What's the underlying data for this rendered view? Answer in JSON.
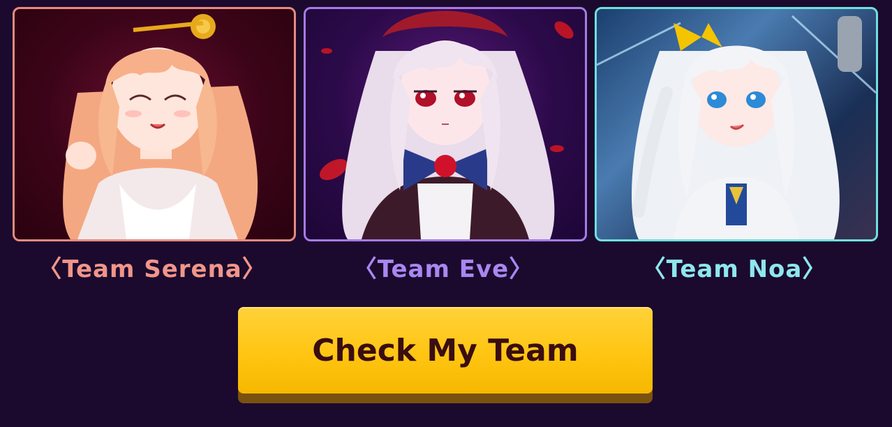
{
  "teams": [
    {
      "id": "serena",
      "label": "〈Team Serena〉",
      "portrait_icon": "serena-portrait-icon",
      "accent_color": "#f0958a",
      "border_color": "#e88a7e"
    },
    {
      "id": "eve",
      "label": "〈Team Eve〉",
      "portrait_icon": "eve-portrait-icon",
      "accent_color": "#a987f0",
      "border_color": "#a77ae6"
    },
    {
      "id": "noa",
      "label": "〈Team Noa〉",
      "portrait_icon": "noa-portrait-icon",
      "accent_color": "#8fe6ee",
      "border_color": "#6fe0e0"
    }
  ],
  "cta": {
    "label": "Check My Team",
    "background_color": "#ffc512",
    "text_color": "#3a0d10"
  },
  "page": {
    "background_color": "#1b0a2e"
  }
}
